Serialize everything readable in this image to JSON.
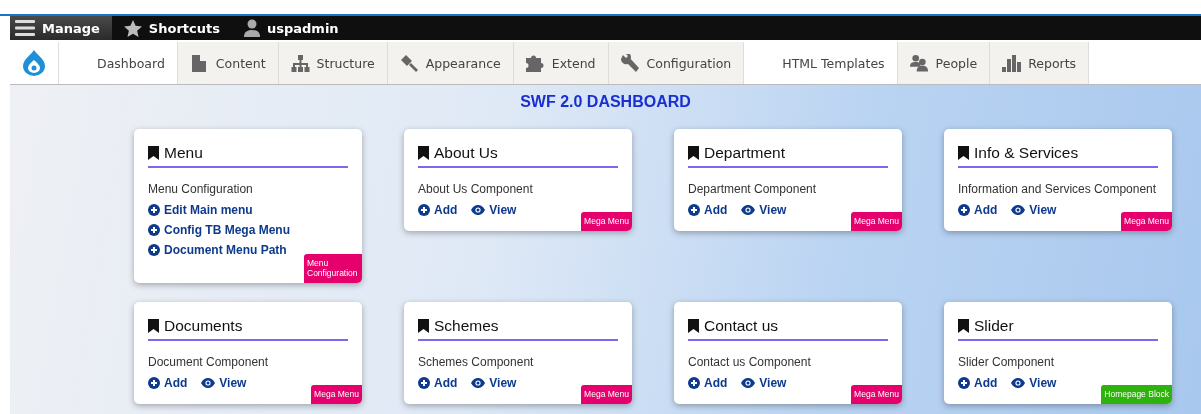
{
  "toolbar": {
    "items": [
      {
        "label": "Manage",
        "selected": true
      },
      {
        "label": "Shortcuts",
        "selected": false
      },
      {
        "label": "uspadmin",
        "selected": false
      }
    ]
  },
  "tray": {
    "items": [
      {
        "label": "Dashboard",
        "selected": true
      },
      {
        "label": "Content",
        "selected": false
      },
      {
        "label": "Structure",
        "selected": false
      },
      {
        "label": "Appearance",
        "selected": false
      },
      {
        "label": "Extend",
        "selected": false
      },
      {
        "label": "Configuration",
        "selected": false
      },
      {
        "label": "HTML Templates",
        "selected": true
      },
      {
        "label": "People",
        "selected": false
      },
      {
        "label": "Reports",
        "selected": false
      }
    ]
  },
  "dashboard": {
    "title": "SWF 2.0 DASHBOARD",
    "cards": [
      {
        "title": "Menu",
        "description": "Menu Configuration",
        "links": [
          {
            "kind": "add",
            "label": "Edit Main menu"
          },
          {
            "kind": "add",
            "label": "Config TB Mega Menu"
          },
          {
            "kind": "add",
            "label": "Document Menu Path"
          }
        ],
        "badge": {
          "label": "Menu Configuration",
          "color": "#e6006e"
        }
      },
      {
        "title": "About Us",
        "description": "About Us Component",
        "links": [
          {
            "kind": "add",
            "label": "Add"
          },
          {
            "kind": "view",
            "label": "View"
          }
        ],
        "badge": {
          "label": "Mega Menu",
          "color": "#e6006e"
        }
      },
      {
        "title": "Department",
        "description": "Department Component",
        "links": [
          {
            "kind": "add",
            "label": "Add"
          },
          {
            "kind": "view",
            "label": "View"
          }
        ],
        "badge": {
          "label": "Mega Menu",
          "color": "#e6006e"
        }
      },
      {
        "title": "Info & Services",
        "description": "Information and Services Component",
        "links": [
          {
            "kind": "add",
            "label": "Add"
          },
          {
            "kind": "view",
            "label": "View"
          }
        ],
        "badge": {
          "label": "Mega Menu",
          "color": "#e6006e"
        }
      },
      {
        "title": "Documents",
        "description": "Document Component",
        "links": [
          {
            "kind": "add",
            "label": "Add"
          },
          {
            "kind": "view",
            "label": "View"
          }
        ],
        "badge": {
          "label": "Mega Menu",
          "color": "#e6006e"
        }
      },
      {
        "title": "Schemes",
        "description": "Schemes Component",
        "links": [
          {
            "kind": "add",
            "label": "Add"
          },
          {
            "kind": "view",
            "label": "View"
          }
        ],
        "badge": {
          "label": "Mega Menu",
          "color": "#e6006e"
        }
      },
      {
        "title": "Contact us",
        "description": "Contact us Component",
        "links": [
          {
            "kind": "add",
            "label": "Add"
          },
          {
            "kind": "view",
            "label": "View"
          }
        ],
        "badge": {
          "label": "Mega Menu",
          "color": "#e6006e"
        }
      },
      {
        "title": "Slider",
        "description": "Slider Component",
        "links": [
          {
            "kind": "add",
            "label": "Add"
          },
          {
            "kind": "view",
            "label": "View"
          }
        ],
        "badge": {
          "label": "Homepage Block",
          "color": "#2eb20c"
        }
      }
    ]
  }
}
